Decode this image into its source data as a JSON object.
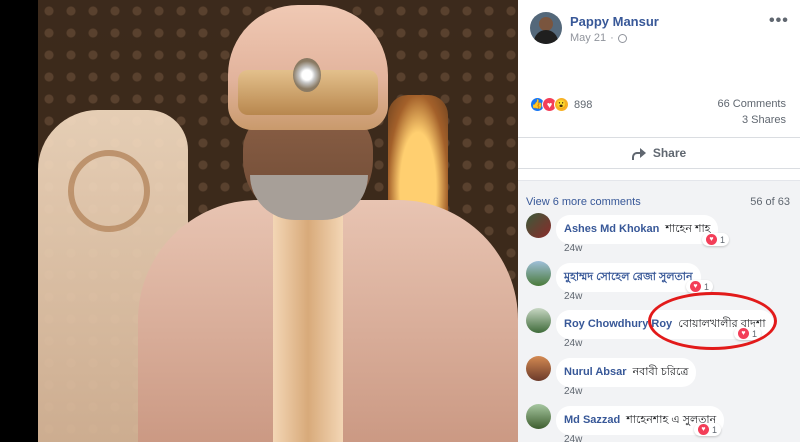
{
  "post": {
    "author": "Pappy Mansur",
    "date": "May 21",
    "dot": "·",
    "more_icon": "more-options-icon",
    "more_label": "•••",
    "reactions_count": "898",
    "comments_count": "66 Comments",
    "shares_count": "3 Shares",
    "share_label": "Share"
  },
  "reactions": [
    {
      "name": "like-icon",
      "glyph": "👍",
      "color": "#1877f2"
    },
    {
      "name": "love-icon",
      "glyph": "♥",
      "color": "#f33e58"
    },
    {
      "name": "wow-icon",
      "glyph": "😮",
      "color": "#f7b125"
    }
  ],
  "comments_section": {
    "view_more": "View 6 more comments",
    "pager": "56 of 63"
  },
  "comments": [
    {
      "name": "Ashes Md Khokan",
      "text": "শাহেন শাহ",
      "time": "24w",
      "likes": "1"
    },
    {
      "name": "মুহাম্মদ সোহেল রেজা সুলতান",
      "text": "",
      "time": "24w",
      "likes": "1"
    },
    {
      "name": "Roy Chowdhury Roy",
      "text": "বোয়ালখালীর বাদশা",
      "time": "24w",
      "likes": "1"
    },
    {
      "name": "Nurul Absar",
      "text": "নবাবী চরিত্রে",
      "time": "24w",
      "likes": ""
    },
    {
      "name": "Md Sazzad",
      "text": "শাহেনশাহ এ সুলতান",
      "time": "24w",
      "likes": "1"
    }
  ],
  "colors": {
    "link": "#385898",
    "highlight_ring": "#e21a1a",
    "love": "#f33e58"
  }
}
